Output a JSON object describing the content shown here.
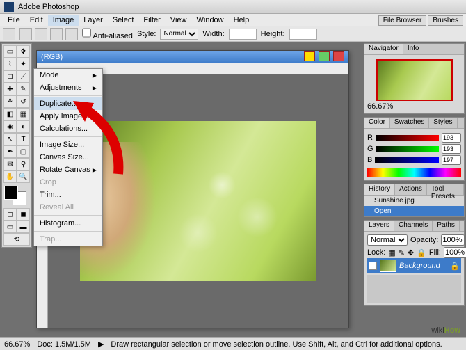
{
  "window": {
    "title": "Adobe Photoshop"
  },
  "menu": [
    "File",
    "Edit",
    "Image",
    "Layer",
    "Select",
    "Filter",
    "View",
    "Window",
    "Help"
  ],
  "menu_active_index": 2,
  "optbar": {
    "antialias": "Anti-aliased",
    "style_label": "Style:",
    "style_value": "Normal",
    "width_label": "Width:",
    "height_label": "Height:"
  },
  "topbuttons": [
    "File Browser",
    "Brushes"
  ],
  "dropdown": {
    "items": [
      {
        "label": "Mode",
        "sub": true
      },
      {
        "label": "Adjustments",
        "sub": true,
        "sep": true
      },
      {
        "label": "Duplicate...",
        "hover": true
      },
      {
        "label": "Apply Image..."
      },
      {
        "label": "Calculations...",
        "sep": true
      },
      {
        "label": "Image Size..."
      },
      {
        "label": "Canvas Size..."
      },
      {
        "label": "Rotate Canvas",
        "sub": true
      },
      {
        "label": "Crop",
        "disabled": true
      },
      {
        "label": "Trim..."
      },
      {
        "label": "Reveal All",
        "disabled": true,
        "sep": true
      },
      {
        "label": "Histogram...",
        "sep": true
      },
      {
        "label": "Trap...",
        "disabled": true
      }
    ]
  },
  "document": {
    "title_suffix": "(RGB)"
  },
  "panels": {
    "navigator": {
      "tabs": [
        "Navigator",
        "Info"
      ],
      "zoom": "66.67%"
    },
    "color": {
      "tabs": [
        "Color",
        "Swatches",
        "Styles"
      ],
      "r": "193",
      "g": "193",
      "b": "197"
    },
    "history": {
      "tabs": [
        "History",
        "Actions",
        "Tool Presets"
      ],
      "doc": "Sunshine.jpg",
      "state": "Open"
    },
    "layers": {
      "tabs": [
        "Layers",
        "Channels",
        "Paths"
      ],
      "mode": "Normal",
      "opacity_label": "Opacity:",
      "opacity": "100%",
      "lock_label": "Lock:",
      "fill_label": "Fill:",
      "fill": "100%",
      "layer_name": "Background"
    }
  },
  "status": {
    "zoom": "66.67%",
    "doc": "Doc: 1.5M/1.5M",
    "hint": "Draw rectangular selection or move selection outline. Use Shift, Alt, and Ctrl for additional options."
  },
  "watermark": {
    "a": "wiki",
    "b": "How"
  }
}
